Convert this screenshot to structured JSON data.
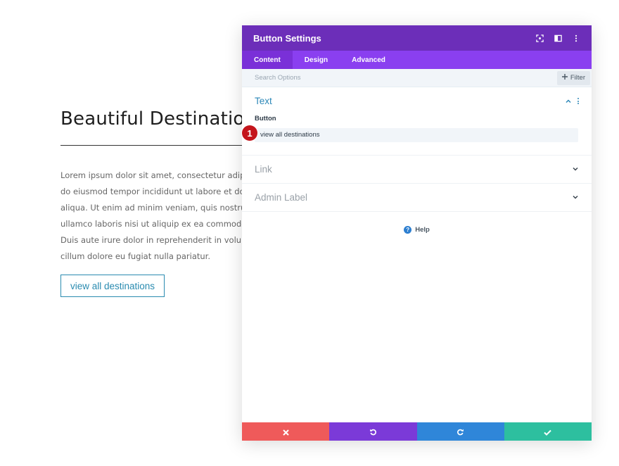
{
  "page": {
    "title": "Beautiful Destinations",
    "body_lines": [
      "Lorem ipsum dolor sit amet, consectetur adipiscing elit, sed",
      "do eiusmod tempor incididunt ut labore et dolore magna",
      "aliqua. Ut enim ad minim veniam, quis nostrud exercitation",
      "ullamco laboris nisi ut aliquip ex ea commodo consequat.",
      "Duis aute irure dolor in reprehenderit in voluptate velit esse",
      "cillum dolore eu fugiat nulla pariatur."
    ],
    "button_label": "view all destinations",
    "accent": "#2a8bb0"
  },
  "modal": {
    "title": "Button Settings",
    "header_icons": [
      "expand-icon",
      "split-view-icon",
      "more-vertical-icon"
    ],
    "tabs": [
      {
        "label": "Content",
        "active": true
      },
      {
        "label": "Design",
        "active": false
      },
      {
        "label": "Advanced",
        "active": false
      }
    ],
    "search": {
      "placeholder": "Search Options",
      "filter_label": "Filter"
    },
    "sections": {
      "text": {
        "title": "Text",
        "field_label": "Button",
        "field_value": "view all destinations"
      },
      "link": {
        "title": "Link"
      },
      "admin": {
        "title": "Admin Label"
      }
    },
    "step_badge": "1",
    "help_label": "Help",
    "colors": {
      "header": "#6c2eb9",
      "tabs": "#8a3ff0",
      "cancel": "#ef5a5a",
      "undo": "#7b3ad8",
      "redo": "#2f86d9",
      "save": "#2dbf9f"
    },
    "footer_icons": [
      "close-icon",
      "undo-icon",
      "redo-icon",
      "check-icon"
    ]
  }
}
